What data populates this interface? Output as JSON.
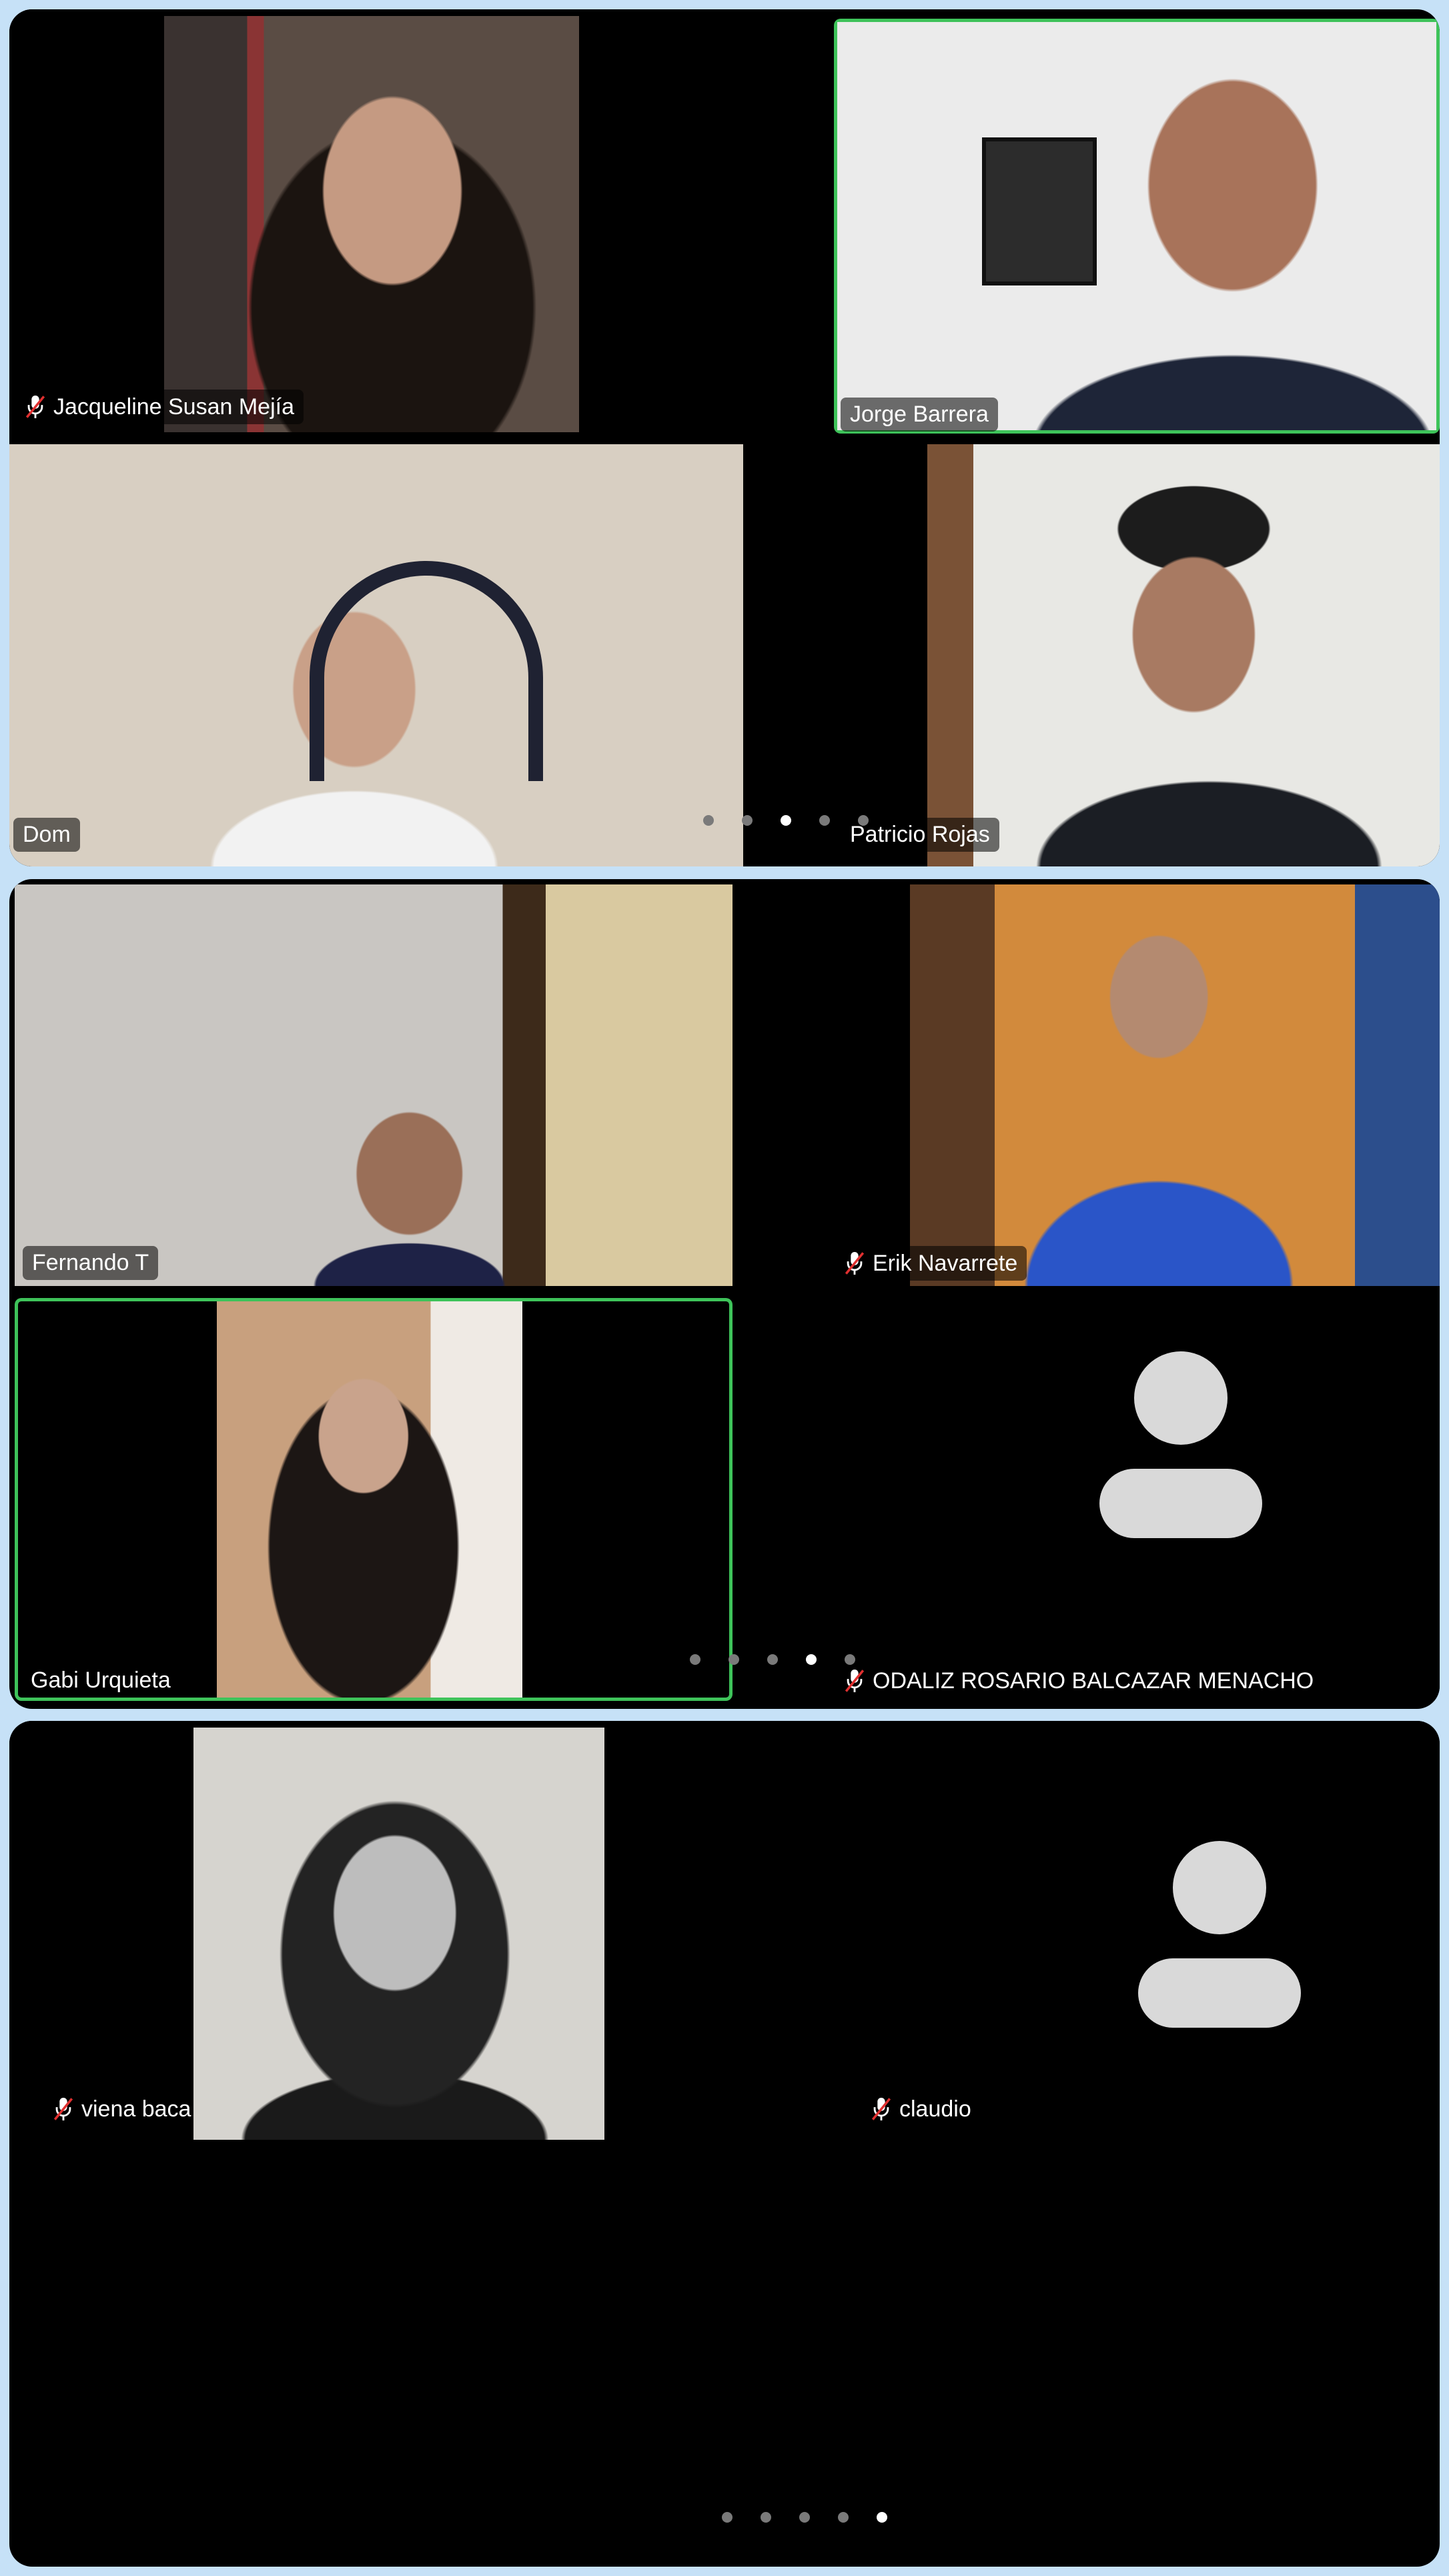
{
  "participants": {
    "p1": {
      "name": "Jacqueline Susan Mejía",
      "muted": true
    },
    "p2": {
      "name": "Jorge Barrera",
      "muted": false,
      "speaking": true
    },
    "p3": {
      "name": "Dom",
      "muted": false
    },
    "p4": {
      "name": "Patricio Rojas",
      "muted": false
    },
    "p5": {
      "name": "Fernando T",
      "muted": false
    },
    "p6": {
      "name": "Erik Navarrete",
      "muted": true
    },
    "p7": {
      "name": "Gabi Urquieta",
      "muted": false,
      "speaking": true
    },
    "p8": {
      "name": "ODALIZ ROSARIO BALCAZAR MENACHO",
      "muted": true
    },
    "p9": {
      "name": "viena baca",
      "muted": true
    },
    "p10": {
      "name": "claudio",
      "muted": true
    }
  },
  "pagination": {
    "screen1": {
      "total": 5,
      "active_page": 3
    },
    "screen2": {
      "total": 5,
      "active_page": 4
    },
    "screen3": {
      "total": 5,
      "active_page": 5
    }
  },
  "colors": {
    "page_bg": "#c6e1f7",
    "panel_bg": "#000000",
    "active_speaker": "#3ec35a",
    "avatar": "#d9d9d9"
  },
  "icons": {
    "muted": "mic-off-icon",
    "no_video": "person-silhouette-icon"
  }
}
